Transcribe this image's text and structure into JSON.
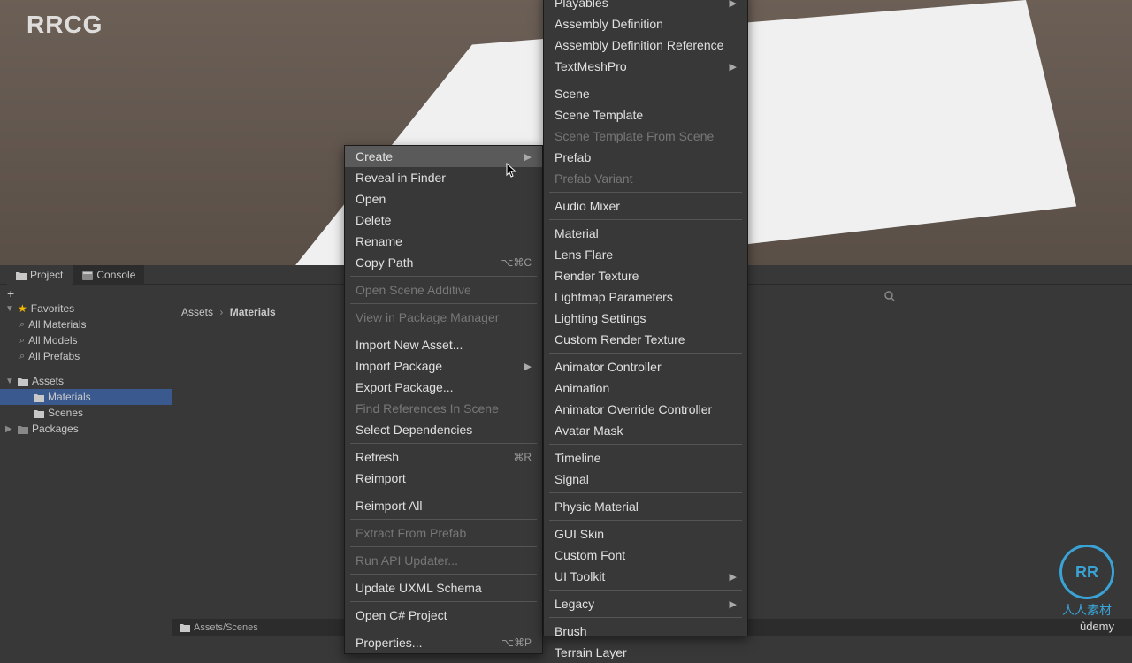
{
  "watermark": "RRCG",
  "sceneWhite": true,
  "tabs": {
    "project": "Project",
    "console": "Console"
  },
  "toolbar": {
    "plus": "+"
  },
  "breadcrumb": {
    "root": "Assets",
    "current": "Materials"
  },
  "leftPanel": {
    "favorites": "Favorites",
    "favItems": [
      "All Materials",
      "All Models",
      "All Prefabs"
    ],
    "assets": "Assets",
    "assetItems": [
      "Materials",
      "Scenes"
    ],
    "packages": "Packages"
  },
  "bottomBar": "Assets/Scenes",
  "contextMenu": [
    {
      "label": "Create",
      "arrow": true,
      "highlighted": true
    },
    {
      "label": "Reveal in Finder"
    },
    {
      "label": "Open"
    },
    {
      "label": "Delete"
    },
    {
      "label": "Rename"
    },
    {
      "label": "Copy Path",
      "shortcut": "⌥⌘C"
    },
    {
      "sep": true
    },
    {
      "label": "Open Scene Additive",
      "disabled": true
    },
    {
      "sep": true
    },
    {
      "label": "View in Package Manager",
      "disabled": true
    },
    {
      "sep": true
    },
    {
      "label": "Import New Asset..."
    },
    {
      "label": "Import Package",
      "arrow": true
    },
    {
      "label": "Export Package..."
    },
    {
      "label": "Find References In Scene",
      "disabled": true
    },
    {
      "label": "Select Dependencies"
    },
    {
      "sep": true
    },
    {
      "label": "Refresh",
      "shortcut": "⌘R"
    },
    {
      "label": "Reimport"
    },
    {
      "sep": true
    },
    {
      "label": "Reimport All"
    },
    {
      "sep": true
    },
    {
      "label": "Extract From Prefab",
      "disabled": true
    },
    {
      "sep": true
    },
    {
      "label": "Run API Updater...",
      "disabled": true
    },
    {
      "sep": true
    },
    {
      "label": "Update UXML Schema"
    },
    {
      "sep": true
    },
    {
      "label": "Open C# Project"
    },
    {
      "sep": true
    },
    {
      "label": "Properties...",
      "shortcut": "⌥⌘P"
    }
  ],
  "submenu": [
    {
      "label": "Playables",
      "arrow": true
    },
    {
      "label": "Assembly Definition"
    },
    {
      "label": "Assembly Definition Reference"
    },
    {
      "label": "TextMeshPro",
      "arrow": true
    },
    {
      "sep": true
    },
    {
      "label": "Scene"
    },
    {
      "label": "Scene Template"
    },
    {
      "label": "Scene Template From Scene",
      "disabled": true
    },
    {
      "label": "Prefab"
    },
    {
      "label": "Prefab Variant",
      "disabled": true
    },
    {
      "sep": true
    },
    {
      "label": "Audio Mixer"
    },
    {
      "sep": true
    },
    {
      "label": "Material"
    },
    {
      "label": "Lens Flare"
    },
    {
      "label": "Render Texture"
    },
    {
      "label": "Lightmap Parameters"
    },
    {
      "label": "Lighting Settings"
    },
    {
      "label": "Custom Render Texture"
    },
    {
      "sep": true
    },
    {
      "label": "Animator Controller"
    },
    {
      "label": "Animation"
    },
    {
      "label": "Animator Override Controller"
    },
    {
      "label": "Avatar Mask"
    },
    {
      "sep": true
    },
    {
      "label": "Timeline"
    },
    {
      "label": "Signal"
    },
    {
      "sep": true
    },
    {
      "label": "Physic Material"
    },
    {
      "sep": true
    },
    {
      "label": "GUI Skin"
    },
    {
      "label": "Custom Font"
    },
    {
      "label": "UI Toolkit",
      "arrow": true
    },
    {
      "sep": true
    },
    {
      "label": "Legacy",
      "arrow": true
    },
    {
      "sep": true
    },
    {
      "label": "Brush"
    },
    {
      "label": "Terrain Layer"
    }
  ],
  "logo": {
    "badge": "RR",
    "text": "人人素材"
  },
  "udemy": "ûdemy"
}
